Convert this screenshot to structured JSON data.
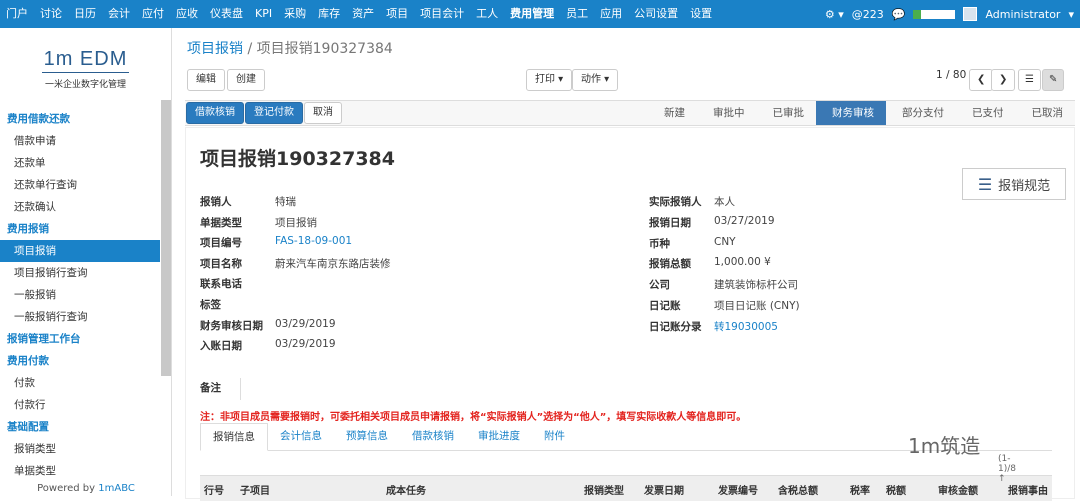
{
  "topnav": {
    "items": [
      "门户",
      "讨论",
      "日历",
      "会计",
      "应付",
      "应收",
      "仪表盘",
      "KPI",
      "采购",
      "库存",
      "资产",
      "项目",
      "项目会计",
      "工人",
      "费用管理",
      "员工",
      "应用",
      "公司设置",
      "设置"
    ],
    "active": "费用管理",
    "notif_count": "@223",
    "user": "Administrator"
  },
  "logo": {
    "title": "1m EDM",
    "subtitle": "一米企业数字化管理"
  },
  "sidebar": {
    "sections": [
      {
        "title": "费用借款还款",
        "items": [
          "借款申请",
          "还款单",
          "还款单行查询",
          "还款确认"
        ]
      },
      {
        "title": "费用报销",
        "items": [
          "项目报销",
          "项目报销行查询",
          "一般报销",
          "一般报销行查询"
        ]
      },
      {
        "title": "报销管理工作台",
        "items": []
      },
      {
        "title": "费用付款",
        "items": [
          "付款",
          "付款行"
        ]
      },
      {
        "title": "基础配置",
        "items": [
          "报销类型",
          "单据类型"
        ]
      }
    ],
    "active": "项目报销",
    "powered_prefix": "Powered by ",
    "powered_brand": "1mABC"
  },
  "breadcrumb": {
    "parent": "项目报销",
    "sep": "/",
    "current": "项目报销190327384"
  },
  "toolbar": {
    "edit": "编辑",
    "create": "创建",
    "print": "打印",
    "action": "动作",
    "pager": "1 / 80"
  },
  "actions": {
    "loan": "借款核销",
    "pay": "登记付款",
    "cancel": "取消"
  },
  "status": {
    "steps": [
      "新建",
      "审批中",
      "已审批",
      "财务审核",
      "部分支付",
      "已支付",
      "已取消"
    ],
    "current": "财务审核"
  },
  "form": {
    "title": "项目报销190327384",
    "policy_button": "报销规范",
    "left": [
      {
        "label": "报销人",
        "value": "特瑞",
        "link": false
      },
      {
        "label": "单据类型",
        "value": "项目报销",
        "link": false
      },
      {
        "label": "项目编号",
        "value": "FAS-18-09-001",
        "link": true
      },
      {
        "label": "项目名称",
        "value": "蔚来汽车南京东路店装修",
        "link": false
      },
      {
        "label": "联系电话",
        "value": "",
        "link": false
      },
      {
        "label": "标签",
        "value": "",
        "link": false
      },
      {
        "label": "财务审核日期",
        "value": "03/29/2019",
        "link": false
      },
      {
        "label": "入账日期",
        "value": "03/29/2019",
        "link": false
      }
    ],
    "right": [
      {
        "label": "实际报销人",
        "value": "本人",
        "link": false
      },
      {
        "label": "报销日期",
        "value": "03/27/2019",
        "link": false
      },
      {
        "label": "币种",
        "value": "CNY",
        "link": false
      },
      {
        "label": "报销总额",
        "value": "1,000.00 ¥",
        "link": false
      },
      {
        "label": "公司",
        "value": "建筑装饰标杆公司",
        "link": false
      },
      {
        "label": "日记账",
        "value": "项目日记账 (CNY)",
        "link": false
      },
      {
        "label": "日记账分录",
        "value": "转19030005",
        "link": true
      }
    ],
    "remark_label": "备注",
    "note": "注：非项目成员需要报销时，可委托相关项目成员申请报销，将“实际报销人”选择为“他人”，填写实际收款人等信息即可。"
  },
  "tabs": [
    "报销信息",
    "会计信息",
    "预算信息",
    "借款核销",
    "审批进度",
    "附件"
  ],
  "table": {
    "headers": [
      "行号",
      "子项目",
      "成本任务",
      "报销类型",
      "发票日期",
      "发票编号",
      "含税总额",
      "税率",
      "税额",
      "审核金额",
      "报销事由"
    ]
  },
  "watermark": {
    "text": "1m筑造",
    "sub": "(1-1)/8 ↑"
  }
}
